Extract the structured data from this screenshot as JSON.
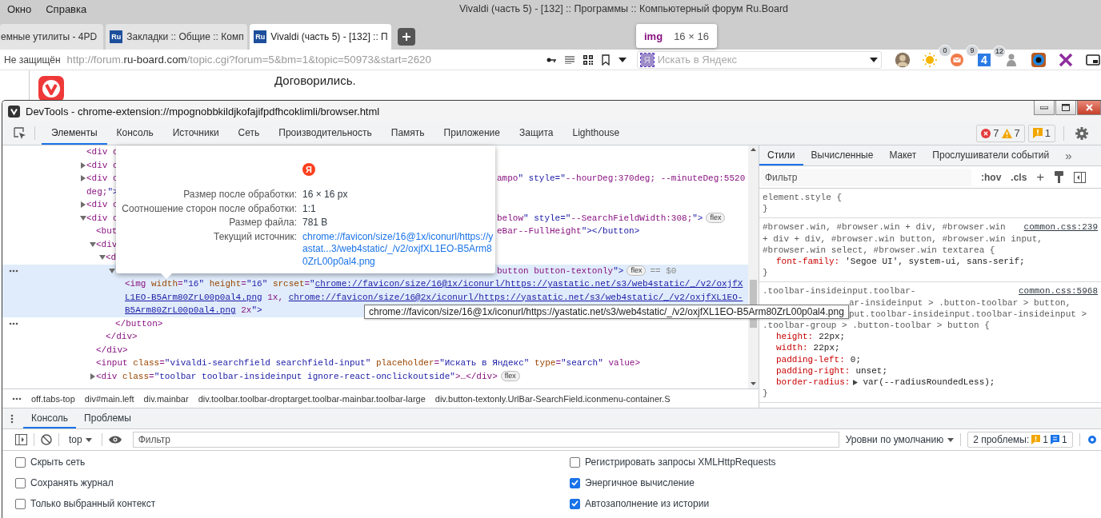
{
  "menu": [
    {
      "label": "Окно"
    },
    {
      "label": "Справка"
    }
  ],
  "window_title": "Vivaldi (часть 5) - [132] :: Программы :: Компьютерный форум Ru.Board",
  "tabs": [
    {
      "title": "емные утилиты - 4PD",
      "favicon": false,
      "selected": false
    },
    {
      "title": "Закладки :: Общие :: Комп",
      "favicon": true,
      "icon_text": "Ru",
      "selected": false
    },
    {
      "title": "Vivaldi (часть 5) - [132] :: П",
      "favicon": true,
      "icon_text": "Ru",
      "selected": true
    }
  ],
  "inspect_tooltip": {
    "tag": "img",
    "size": "16 × 16"
  },
  "address_bar": {
    "security": "Не защищён",
    "url_start": "http://forum.",
    "url_domain": "ru-board.com",
    "url_rest": "/topic.cgi?forum=5&bm=1&topic=50973&start=2620"
  },
  "search": {
    "icon_text": "Я",
    "placeholder": "Искать в Яндекс"
  },
  "extensions": [
    {
      "kind": "avatar"
    },
    {
      "kind": "sun",
      "badge": "0"
    },
    {
      "kind": "mail",
      "badge": "9"
    },
    {
      "kind": "tile",
      "icon_text": "4",
      "badge": "12"
    },
    {
      "kind": "figure"
    },
    {
      "kind": "ring"
    },
    {
      "kind": "cross"
    },
    {
      "kind": "window"
    }
  ],
  "page": {
    "text": "Договорились."
  },
  "devtools": {
    "title": "DevTools - chrome-extension://mpognobbkildjkofajifpdfhcoklimli/browser.html",
    "tabs": [
      {
        "label": "Элементы",
        "selected": true
      },
      {
        "label": "Консоль",
        "selected": false
      },
      {
        "label": "Источники",
        "selected": false
      },
      {
        "label": "Сеть",
        "selected": false
      },
      {
        "label": "Производительность",
        "selected": false
      },
      {
        "label": "Память",
        "selected": false
      },
      {
        "label": "Приложение",
        "selected": false
      },
      {
        "label": "Защита",
        "selected": false
      },
      {
        "label": "Lighthouse",
        "selected": false
      }
    ],
    "errors": "7",
    "warnings": "7",
    "issues": "1",
    "tree": [
      {
        "text": "<div c",
        "selected": false
      },
      {
        "text": "<div c",
        "expanded": false,
        "selected": false
      },
      {
        "text": "<div c",
        "text_right": "ampo\" style=\"--hourDeg:370deg; --minuteDeg:5520",
        "wrap": "deg;\">",
        "expanded": false,
        "selected": false
      },
      {
        "text": "<div c",
        "expanded": false,
        "selected": false
      },
      {
        "text": "<div c",
        "text_right": "below\" style=\"--SearchFieldWidth:308;\">",
        "badge": "flex",
        "expanded": true,
        "selected": false,
        "children": [
          {
            "text": "<but",
            "text_right": "eBar--FullHeight\"></button>",
            "selected": false
          },
          {
            "text": "<div",
            "expanded": true,
            "selected": false,
            "closing": "</div>",
            "children": [
              {
                "text": "<d",
                "expanded": true,
                "selected": false,
                "closing": "</div>",
                "children": [
                  {
                    "text_right": "button button-textonly\">",
                    "badge": "flex",
                    "marker": "== $0",
                    "expanded": true,
                    "selected": true,
                    "closing": "</button>",
                    "children": [
                      {
                        "lines": [
                          [
                            "<img width=\"16\" height=\"16\" srcset=\"",
                            {
                              "link": "chrome://favicon/size/16@1x/iconurl/https://yastatic.net/s3/web4static/_/v2/oxjfX"
                            }
                          ],
                          [
                            {
                              "link": "L1EO-B5Arm80ZrL00p0al4.png"
                            },
                            " 1x, ",
                            {
                              "link": "chrome://favicon/size/16@2x/iconurl/https://yastatic.net/s3/web4static/_/v2/oxjfXL1EO-"
                            }
                          ],
                          [
                            {
                              "link": "B5Arm80ZrL00p0al4.png"
                            },
                            " 2x\">"
                          ]
                        ],
                        "selected": false
                      }
                    ]
                  }
                ]
              }
            ]
          },
          {
            "text": "<input class=\"vivaldi-searchfield searchfield-input\" placeholder=\"Искать в Яндекс\" type=\"search\" value>",
            "selected": false
          },
          {
            "text": "<div class=\"toolbar toolbar-insideinput ignore-react-onclickoutside\">…</div>",
            "badge": "flex",
            "expanded": false,
            "selected": false
          }
        ]
      }
    ],
    "preview": {
      "icon_text": "Я",
      "rows": [
        {
          "label": "Размер после обработки:",
          "value": "16 × 16 px"
        },
        {
          "label": "Соотношение сторон после обработки:",
          "value": "1:1"
        },
        {
          "label": "Размер файла:",
          "value": "781 B"
        },
        {
          "label": "Текущий источник:",
          "value": "chrome://favicon/size/16@1x/iconurl/https://yastat...3/web4static/_/v2/oxjfXL1EO-B5Arm80ZrL00p0al4.png",
          "kind": "link"
        }
      ]
    },
    "link_tooltip": "chrome://favicon/size/16@1x/iconurl/https://yastatic.net/s3/web4static/_/v2/oxjfXL1EO-B5Arm80ZrL00p0al4.png",
    "breadcrumbs": [
      "off.tabs-top",
      "div#main.left",
      "div.mainbar",
      "div.toolbar.toolbar-droptarget.toolbar-mainbar.toolbar-large",
      "div.button-textonly.UrlBar-SearchField.iconmenu-container.S"
    ],
    "styles": {
      "tabs": [
        {
          "label": "Стили",
          "selected": true
        },
        {
          "label": "Вычисленные",
          "selected": false
        },
        {
          "label": "Макет",
          "selected": false
        },
        {
          "label": "Прослушиватели событий",
          "selected": false
        }
      ],
      "more": "»",
      "filter": {
        "placeholder": "Фильтр"
      },
      "hov": ":hov",
      "cls": ".cls",
      "add": "+",
      "rules": [
        {
          "selector": [
            {
              "text": "element.style {"
            }
          ],
          "close": "}"
        },
        {
          "selector": [
            {
              "text": "#browser.win, #browser.win + div, #browser.win"
            },
            {
              "text": "+ div + div, #browser.win button, #browser.win input,"
            },
            {
              "text": "#browser.win select, #browser.win textarea {"
            }
          ],
          "source": "common.css:239",
          "properties": [
            {
              "name": "font-family:",
              "value": "'Segoe UI', system-ui, sans-serif;"
            }
          ],
          "close": "}"
        },
        {
          "selector": [
            {
              "text": ".toolbar-insideinput.toolbar-"
            },
            {
              "text": "ar-insideinput > .button-toolbar > button,",
              "partial": true
            },
            {
              "text": "put.toolbar-insideinput.toolbar-insideinput >",
              "partial": true
            },
            {
              "text": ".toolbar-group > .button-toolbar > button {"
            }
          ],
          "source": "common.css:5968",
          "properties": [
            {
              "name": "height:",
              "value": "22px;"
            },
            {
              "name": "width:",
              "value": "22px;"
            },
            {
              "name": "padding-left:",
              "value": "0;"
            },
            {
              "name": "padding-right:",
              "value": "unset;"
            },
            {
              "name": "border-radius:",
              "value": "var(--radiusRoundedLess);",
              "expandable": true
            }
          ],
          "close": "}"
        }
      ]
    },
    "drawer": {
      "tabs": [
        {
          "label": "Консоль",
          "selected": true
        },
        {
          "label": "Проблемы",
          "selected": false
        }
      ],
      "context": "top",
      "filter": {
        "placeholder": "Фильтр"
      },
      "levels": "Уровни по умолчанию",
      "issues_label": "2 проблемы:",
      "issues_warn": "1",
      "issues_info": "1",
      "settings": [
        {
          "label": "Скрыть сеть",
          "checked": false
        },
        {
          "label": "Сохранять журнал",
          "checked": false
        },
        {
          "label": "Только выбранный контекст",
          "checked": false
        },
        {
          "label": "Регистрировать запросы XMLHttpRequests",
          "checked": false
        },
        {
          "label": "Энергичное вычисление",
          "checked": true
        },
        {
          "label": "Автозаполнение из истории",
          "checked": true
        }
      ]
    }
  }
}
